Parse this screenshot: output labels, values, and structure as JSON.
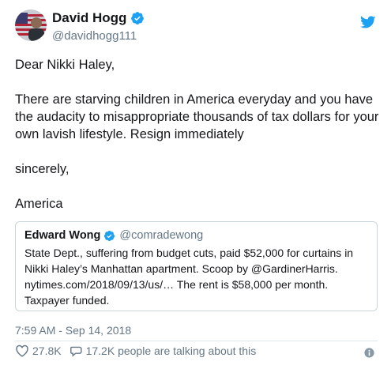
{
  "author": {
    "display_name": "David Hogg",
    "handle": "@davidhogg111"
  },
  "tweet": {
    "paragraphs": [
      "Dear Nikki Haley,",
      "There are starving children in America everyday and you have the audacity to misappropriate thousands of tax dollars for your own lavish lifestyle. Resign immediately",
      "sincerely,",
      "America"
    ],
    "timestamp": "7:59 AM - Sep 14, 2018"
  },
  "quoted_tweet": {
    "display_name": "Edward Wong",
    "handle": "@comradewong",
    "text": "State Dept., suffering from budget cuts, paid $52,000 for curtains in Nikki Haley’s Manhattan apartment. Scoop by @GardinerHarris. nytimes.com/2018/09/13/us/… The rent is $58,000 per month. Taxpayer funded."
  },
  "actions": {
    "likes": "27.8K",
    "replies_text": "17.2K people are talking about this"
  },
  "icons": {
    "verified": "verified-badge-icon",
    "logo": "twitter-bird-icon",
    "like": "heart-icon",
    "reply": "speech-bubble-icon",
    "info": "info-icon"
  },
  "colors": {
    "accent": "#1da1f2",
    "muted": "#657786",
    "text": "#14171a",
    "border": "#ccd6dd"
  }
}
